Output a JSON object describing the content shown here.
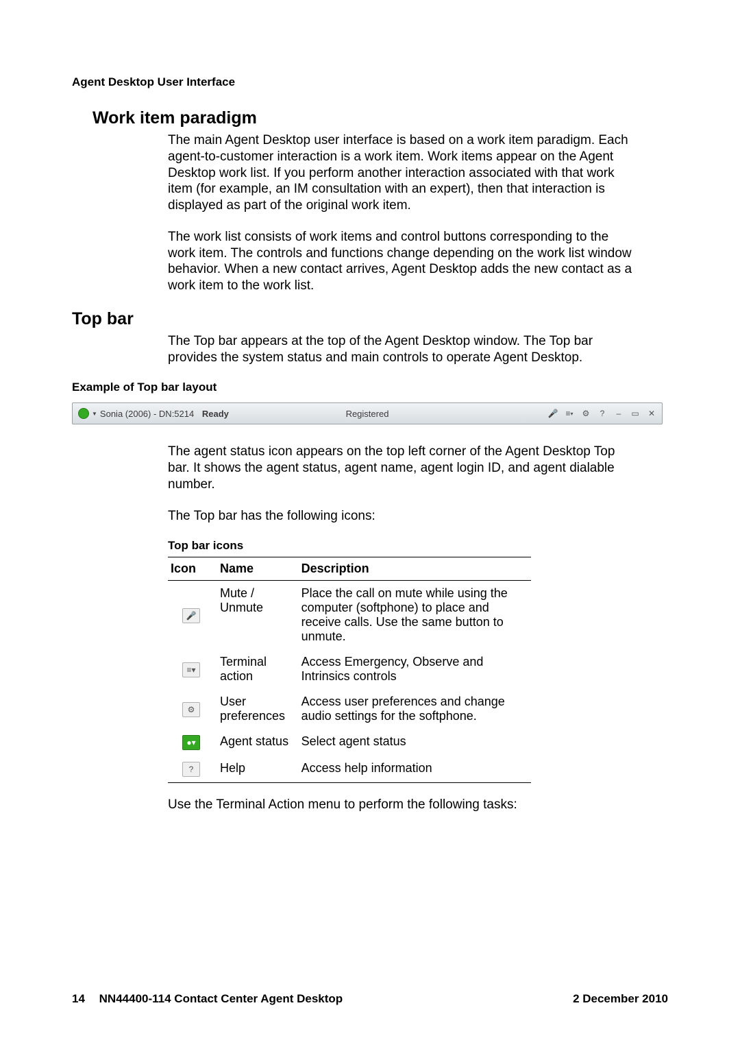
{
  "header": "Agent Desktop User Interface",
  "sections": {
    "work_item": {
      "title": "Work item paradigm",
      "p1": "The main Agent Desktop user interface is based on a work item paradigm. Each agent-to-customer interaction is a work item. Work items appear on the Agent Desktop work list. If you perform another interaction associated with that work item (for example, an IM consultation with an expert), then that interaction is displayed as part of the original work item.",
      "p2": "The work list consists of work items and control buttons corresponding to the work item. The controls and functions change depending on the work list window behavior. When a new contact arrives, Agent Desktop adds the new contact as a work item to the work list."
    },
    "top_bar": {
      "title": "Top bar",
      "p1": "The Top bar appears at the top of the Agent Desktop window. The Top bar provides the system status and main controls to operate Agent Desktop.",
      "example_label": "Example of Top bar layout",
      "p_after_img": "The agent status icon appears on the top left corner of the Agent Desktop Top bar. It shows the agent status, agent name, agent login ID, and agent dialable number.",
      "p_icons_intro": "The Top bar has the following icons:",
      "table_caption": "Top bar icons",
      "p_terminal": "Use the Terminal Action menu to perform the following tasks:"
    }
  },
  "topbar": {
    "agent_label": "Sonia (2006) - DN:5214",
    "agent_state": "Ready",
    "center_status": "Registered",
    "right_icons": [
      "mute-icon",
      "terminal-icon",
      "gear-icon",
      "help-icon",
      "minimize-icon",
      "maximize-icon",
      "close-icon"
    ]
  },
  "icons_table": {
    "headers": [
      "Icon",
      "Name",
      "Description"
    ],
    "rows": [
      {
        "icon": "mute-icon",
        "glyph": "🎤",
        "name": "Mute / Unmute",
        "desc": "Place the call on mute while using the computer (softphone) to place and receive calls. Use the same button to unmute."
      },
      {
        "icon": "terminal-icon",
        "glyph": "≡▾",
        "name": "Terminal action",
        "desc": "Access Emergency, Observe and Intrinsics controls"
      },
      {
        "icon": "gear-icon",
        "glyph": "⚙",
        "name": "User preferences",
        "desc": "Access user preferences and change audio settings for the softphone."
      },
      {
        "icon": "agent-status-icon",
        "glyph": "●▾",
        "name": "Agent status",
        "desc": "Select agent status"
      },
      {
        "icon": "help-icon",
        "glyph": "?",
        "name": "Help",
        "desc": "Access help information"
      }
    ]
  },
  "footer": {
    "page_number": "14",
    "doc_id": "NN44400-114 Contact Center Agent Desktop",
    "date": "2 December 2010"
  }
}
